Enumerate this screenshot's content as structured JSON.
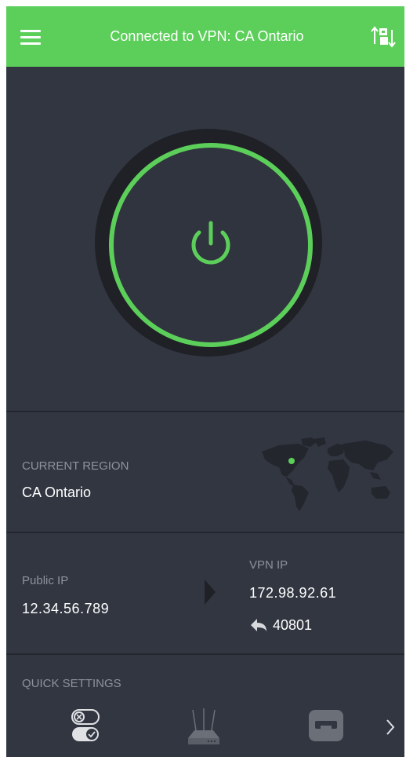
{
  "header": {
    "title": "Connected to VPN: CA Ontario"
  },
  "status": {
    "connected": true,
    "accent_color": "#5ccf5a"
  },
  "region": {
    "label": "CURRENT REGION",
    "value": "CA Ontario"
  },
  "ip": {
    "public_label": "Public IP",
    "public_value": "12.34.56.789",
    "vpn_label": "VPN IP",
    "vpn_value": "172.98.92.61",
    "port_value": "40801"
  },
  "quick_settings": {
    "label": "QUICK SETTINGS",
    "items": [
      "toggle-settings-icon",
      "router-icon",
      "card-icon",
      "chevron-right-icon"
    ]
  }
}
